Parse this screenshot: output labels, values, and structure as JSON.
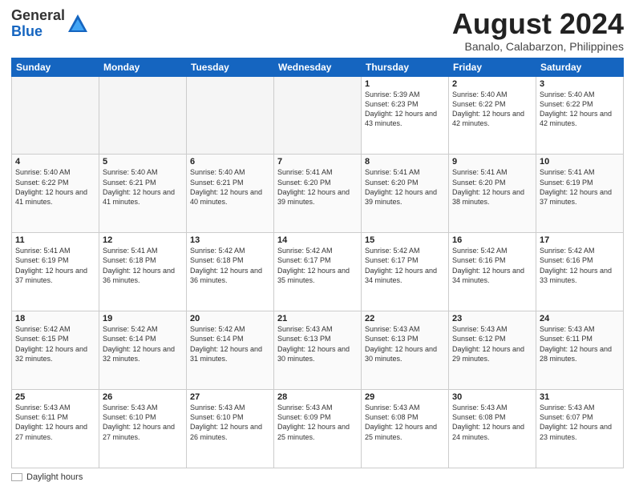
{
  "header": {
    "logo_general": "General",
    "logo_blue": "Blue",
    "month_title": "August 2024",
    "subtitle": "Banalo, Calabarzon, Philippines"
  },
  "footer": {
    "label": "Daylight hours"
  },
  "weekdays": [
    "Sunday",
    "Monday",
    "Tuesday",
    "Wednesday",
    "Thursday",
    "Friday",
    "Saturday"
  ],
  "weeks": [
    [
      {
        "day": "",
        "empty": true
      },
      {
        "day": "",
        "empty": true
      },
      {
        "day": "",
        "empty": true
      },
      {
        "day": "",
        "empty": true
      },
      {
        "day": "1",
        "sunrise": "5:39 AM",
        "sunset": "6:23 PM",
        "daylight": "12 hours and 43 minutes."
      },
      {
        "day": "2",
        "sunrise": "5:40 AM",
        "sunset": "6:22 PM",
        "daylight": "12 hours and 42 minutes."
      },
      {
        "day": "3",
        "sunrise": "5:40 AM",
        "sunset": "6:22 PM",
        "daylight": "12 hours and 42 minutes."
      }
    ],
    [
      {
        "day": "4",
        "sunrise": "5:40 AM",
        "sunset": "6:22 PM",
        "daylight": "12 hours and 41 minutes."
      },
      {
        "day": "5",
        "sunrise": "5:40 AM",
        "sunset": "6:21 PM",
        "daylight": "12 hours and 41 minutes."
      },
      {
        "day": "6",
        "sunrise": "5:40 AM",
        "sunset": "6:21 PM",
        "daylight": "12 hours and 40 minutes."
      },
      {
        "day": "7",
        "sunrise": "5:41 AM",
        "sunset": "6:20 PM",
        "daylight": "12 hours and 39 minutes."
      },
      {
        "day": "8",
        "sunrise": "5:41 AM",
        "sunset": "6:20 PM",
        "daylight": "12 hours and 39 minutes."
      },
      {
        "day": "9",
        "sunrise": "5:41 AM",
        "sunset": "6:20 PM",
        "daylight": "12 hours and 38 minutes."
      },
      {
        "day": "10",
        "sunrise": "5:41 AM",
        "sunset": "6:19 PM",
        "daylight": "12 hours and 37 minutes."
      }
    ],
    [
      {
        "day": "11",
        "sunrise": "5:41 AM",
        "sunset": "6:19 PM",
        "daylight": "12 hours and 37 minutes."
      },
      {
        "day": "12",
        "sunrise": "5:41 AM",
        "sunset": "6:18 PM",
        "daylight": "12 hours and 36 minutes."
      },
      {
        "day": "13",
        "sunrise": "5:42 AM",
        "sunset": "6:18 PM",
        "daylight": "12 hours and 36 minutes."
      },
      {
        "day": "14",
        "sunrise": "5:42 AM",
        "sunset": "6:17 PM",
        "daylight": "12 hours and 35 minutes."
      },
      {
        "day": "15",
        "sunrise": "5:42 AM",
        "sunset": "6:17 PM",
        "daylight": "12 hours and 34 minutes."
      },
      {
        "day": "16",
        "sunrise": "5:42 AM",
        "sunset": "6:16 PM",
        "daylight": "12 hours and 34 minutes."
      },
      {
        "day": "17",
        "sunrise": "5:42 AM",
        "sunset": "6:16 PM",
        "daylight": "12 hours and 33 minutes."
      }
    ],
    [
      {
        "day": "18",
        "sunrise": "5:42 AM",
        "sunset": "6:15 PM",
        "daylight": "12 hours and 32 minutes."
      },
      {
        "day": "19",
        "sunrise": "5:42 AM",
        "sunset": "6:14 PM",
        "daylight": "12 hours and 32 minutes."
      },
      {
        "day": "20",
        "sunrise": "5:42 AM",
        "sunset": "6:14 PM",
        "daylight": "12 hours and 31 minutes."
      },
      {
        "day": "21",
        "sunrise": "5:43 AM",
        "sunset": "6:13 PM",
        "daylight": "12 hours and 30 minutes."
      },
      {
        "day": "22",
        "sunrise": "5:43 AM",
        "sunset": "6:13 PM",
        "daylight": "12 hours and 30 minutes."
      },
      {
        "day": "23",
        "sunrise": "5:43 AM",
        "sunset": "6:12 PM",
        "daylight": "12 hours and 29 minutes."
      },
      {
        "day": "24",
        "sunrise": "5:43 AM",
        "sunset": "6:11 PM",
        "daylight": "12 hours and 28 minutes."
      }
    ],
    [
      {
        "day": "25",
        "sunrise": "5:43 AM",
        "sunset": "6:11 PM",
        "daylight": "12 hours and 27 minutes."
      },
      {
        "day": "26",
        "sunrise": "5:43 AM",
        "sunset": "6:10 PM",
        "daylight": "12 hours and 27 minutes."
      },
      {
        "day": "27",
        "sunrise": "5:43 AM",
        "sunset": "6:10 PM",
        "daylight": "12 hours and 26 minutes."
      },
      {
        "day": "28",
        "sunrise": "5:43 AM",
        "sunset": "6:09 PM",
        "daylight": "12 hours and 25 minutes."
      },
      {
        "day": "29",
        "sunrise": "5:43 AM",
        "sunset": "6:08 PM",
        "daylight": "12 hours and 25 minutes."
      },
      {
        "day": "30",
        "sunrise": "5:43 AM",
        "sunset": "6:08 PM",
        "daylight": "12 hours and 24 minutes."
      },
      {
        "day": "31",
        "sunrise": "5:43 AM",
        "sunset": "6:07 PM",
        "daylight": "12 hours and 23 minutes."
      }
    ]
  ]
}
